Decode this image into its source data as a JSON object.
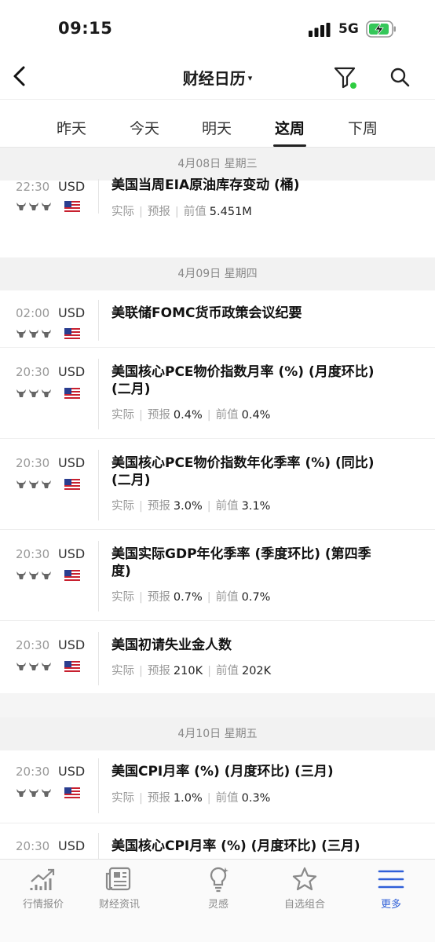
{
  "status_bar": {
    "time": "09:15",
    "network": "5G"
  },
  "nav": {
    "title": "财经日历",
    "title_caret": "▾"
  },
  "tabs": [
    {
      "label": "昨天",
      "active": false
    },
    {
      "label": "今天",
      "active": false
    },
    {
      "label": "明天",
      "active": false
    },
    {
      "label": "这周",
      "active": true
    },
    {
      "label": "下周",
      "active": false
    }
  ],
  "labels": {
    "actual": "实际",
    "forecast": "预报",
    "previous": "前值",
    "separator": "|"
  },
  "days": [
    {
      "date": "4月08日 星期三",
      "events": [
        {
          "time": "22:30",
          "currency": "USD",
          "title": "美国当周EIA原油库存变动 (桶)",
          "forecast": "",
          "previous": "5.451M",
          "importance": 3
        }
      ]
    },
    {
      "date": "4月09日 星期四",
      "events": [
        {
          "time": "02:00",
          "currency": "USD",
          "title": "美联储FOMC货币政策会议纪要",
          "importance": 3
        },
        {
          "time": "20:30",
          "currency": "USD",
          "title": "美国核心PCE物价指数月率 (%) (月度环比) (二月)",
          "forecast": "0.4%",
          "previous": "0.4%",
          "importance": 3
        },
        {
          "time": "20:30",
          "currency": "USD",
          "title": "美国核心PCE物价指数年化季率 (%) (同比) (二月)",
          "forecast": "3.0%",
          "previous": "3.1%",
          "importance": 3
        },
        {
          "time": "20:30",
          "currency": "USD",
          "title": "美国实际GDP年化季率 (季度环比) (第四季度)",
          "forecast": "0.7%",
          "previous": "0.7%",
          "importance": 3
        },
        {
          "time": "20:30",
          "currency": "USD",
          "title": "美国初请失业金人数",
          "forecast": "210K",
          "previous": "202K",
          "importance": 3
        }
      ]
    },
    {
      "date": "4月10日 星期五",
      "events": [
        {
          "time": "20:30",
          "currency": "USD",
          "title": "美国CPI月率 (%) (月度环比) (三月)",
          "forecast": "1.0%",
          "previous": "0.3%",
          "importance": 3
        },
        {
          "time": "20:30",
          "currency": "USD",
          "title": "美国核心CPI月率 (%) (月度环比) (三月)",
          "importance": 3
        }
      ]
    }
  ],
  "bottom_tabs": [
    {
      "label": "行情报价",
      "icon": "chart-trend-icon",
      "active": false
    },
    {
      "label": "财经资讯",
      "icon": "newspaper-icon",
      "active": false
    },
    {
      "label": "灵感",
      "icon": "lightbulb-icon",
      "active": false
    },
    {
      "label": "自选组合",
      "icon": "star-icon",
      "active": false
    },
    {
      "label": "更多",
      "icon": "menu-icon",
      "active": true
    }
  ],
  "colors": {
    "accent": "#2f5fd8",
    "filter_dot": "#2ecc40",
    "battery": "#34c759",
    "flag_red": "#c8202f",
    "flag_blue": "#2a3d8f"
  }
}
